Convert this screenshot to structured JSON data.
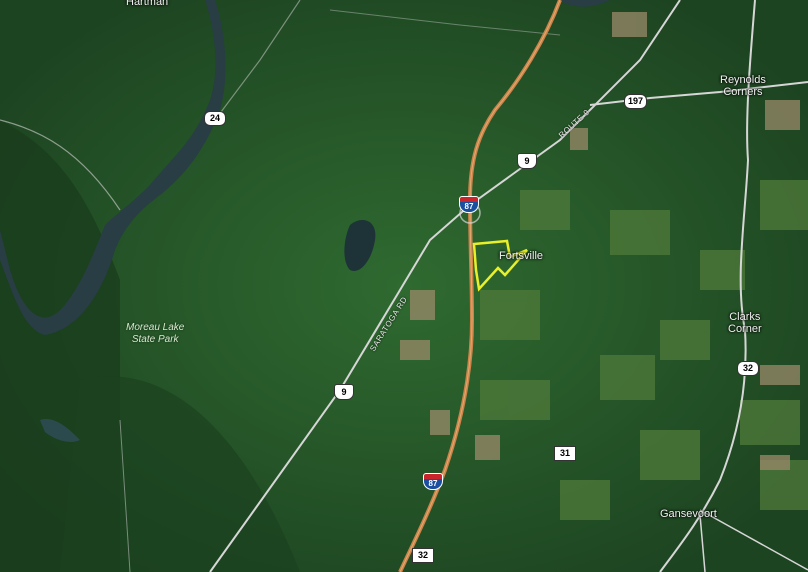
{
  "places": {
    "hartman": "Hartman",
    "reynolds_corners": "Reynolds\nCorners",
    "fortsville": "Fortsville",
    "clarks_corner": "Clarks\nCorner",
    "gansevoort": "Gansevoort"
  },
  "parks": {
    "moreau_lake": "Moreau Lake\nState Park"
  },
  "road_labels": {
    "route9": "ROUTE 9",
    "saratoga_rd": "SARATOGA RD"
  },
  "shields": {
    "i87_top": "87",
    "i87_bottom": "87",
    "us9_top": "9",
    "us9_bottom": "9",
    "r24": "24",
    "r197": "197",
    "r31": "31",
    "r32_right": "32",
    "r32_bottom": "32"
  },
  "colors": {
    "forest": "#1f4a24",
    "field": "#4e7a3c",
    "interstate": "#c9854a",
    "local_road": "#d9d9d9",
    "river": "#2a3f44",
    "parcel_outline": "#e8f02a"
  }
}
